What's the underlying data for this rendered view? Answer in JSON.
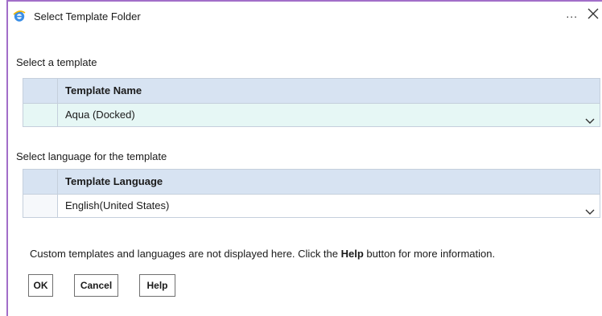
{
  "dialog": {
    "title": "Select Template Folder",
    "more_label": "...",
    "app_icon": "ie-icon",
    "close_icon": "close-icon"
  },
  "template_section": {
    "label": "Select a template",
    "column_header": "Template Name",
    "selected_value": "Aqua (Docked)"
  },
  "language_section": {
    "label": "Select language for the template",
    "column_header": "Template Language",
    "selected_value": "English(United States)"
  },
  "info": {
    "prefix": "Custom templates and languages are not displayed here. Click the ",
    "bold": "Help",
    "suffix": " button for more information."
  },
  "buttons": {
    "ok": "OK",
    "cancel": "Cancel",
    "help": "Help"
  },
  "colors": {
    "accent_border": "#a26ec9",
    "header_bg": "#d7e3f2",
    "selected_row_bg": "#e6f7f5"
  }
}
